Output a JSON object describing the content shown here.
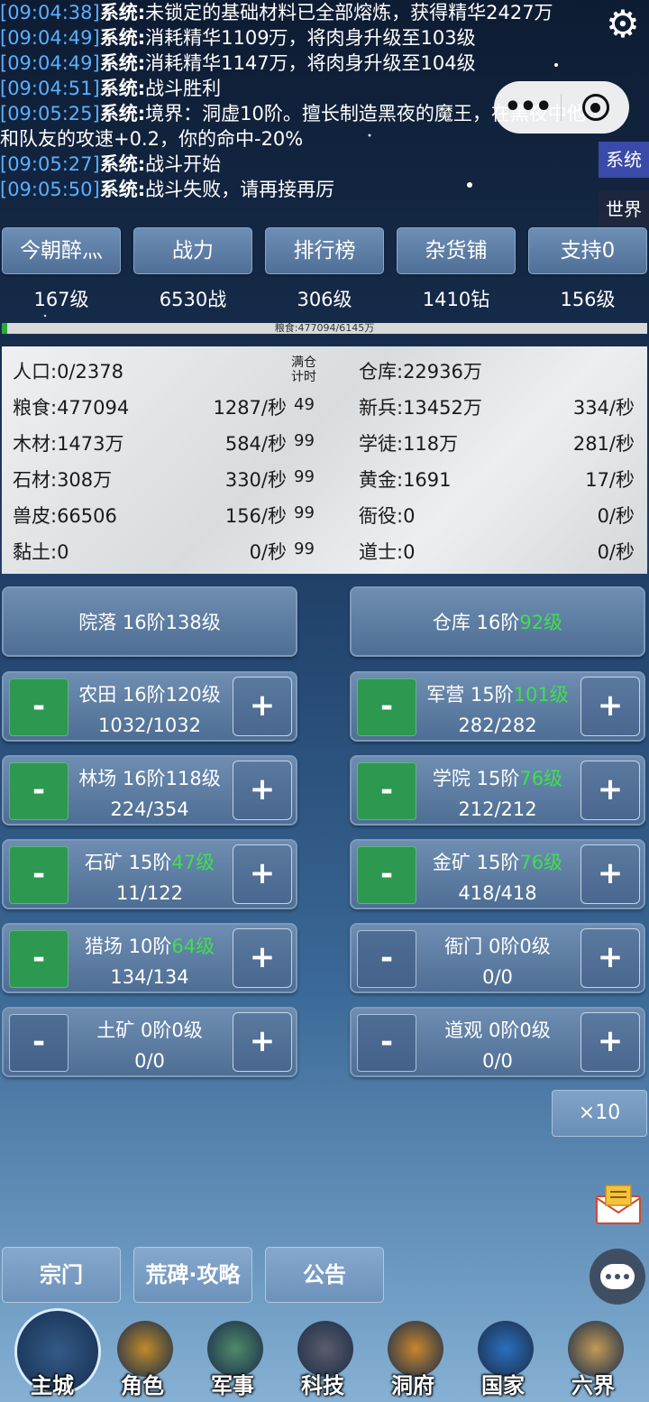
{
  "log": [
    {
      "time": "[09:04:38]",
      "who": "系统:",
      "msg": "未锁定的基础材料已全部熔炼，获得精华2427万"
    },
    {
      "time": "[09:04:49]",
      "who": "系统:",
      "msg": "消耗精华1109万，将肉身升级至103级"
    },
    {
      "time": "[09:04:49]",
      "who": "系统:",
      "msg": "消耗精华1147万，将肉身升级至104级"
    },
    {
      "time": "[09:04:51]",
      "who": "系统:",
      "msg": "战斗胜利"
    },
    {
      "time": "[09:05:25]",
      "who": "系统:",
      "msg": "境界：洞虚10阶。擅长制造黑夜的魔王，在黑夜中他和队友的攻速+0.2，你的命中-20%"
    },
    {
      "time": "[09:05:27]",
      "who": "系统:",
      "msg": "战斗开始"
    },
    {
      "time": "[09:05:50]",
      "who": "系统:",
      "msg": "战斗失败，请再接再厉"
    }
  ],
  "side_tabs": {
    "system": "系统",
    "world": "世界"
  },
  "top_buttons": [
    "今朝醉灬",
    "战力",
    "排行榜",
    "杂货铺",
    "支持0"
  ],
  "stats": [
    "167级",
    "6530战",
    "306级",
    "1410钻",
    "156级"
  ],
  "food_bar": {
    "text": "粮食:477094/6145万",
    "fraction": 0.008
  },
  "resources": {
    "full_time_label": "满仓\n计时",
    "left": [
      {
        "label": "人口:0/2378",
        "rate": "",
        "full": ""
      },
      {
        "label": "粮食:477094",
        "rate": "1287/秒",
        "full": "49"
      },
      {
        "label": "木材:1473万",
        "rate": "584/秒",
        "full": "99"
      },
      {
        "label": "石材:308万",
        "rate": "330/秒",
        "full": "99"
      },
      {
        "label": "兽皮:66506",
        "rate": "156/秒",
        "full": "99"
      },
      {
        "label": "黏土:0",
        "rate": "0/秒",
        "full": "99"
      }
    ],
    "right": [
      {
        "label": "仓库:22936万",
        "rate": ""
      },
      {
        "label": "新兵:13452万",
        "rate": "334/秒"
      },
      {
        "label": "学徒:118万",
        "rate": "281/秒"
      },
      {
        "label": "黄金:1691",
        "rate": "17/秒"
      },
      {
        "label": "衙役:0",
        "rate": "0/秒"
      },
      {
        "label": "道士:0",
        "rate": "0/秒"
      }
    ]
  },
  "buildings": [
    {
      "name": "院落 16阶",
      "level": "138级",
      "green": false,
      "count": "",
      "minus_active": false,
      "has_controls": false
    },
    {
      "name": "仓库 16阶",
      "level": "92级",
      "green": true,
      "count": "",
      "minus_active": false,
      "has_controls": false
    },
    {
      "name": "农田 16阶",
      "level": "120级",
      "green": false,
      "count": "1032/1032",
      "minus_active": true,
      "has_controls": true
    },
    {
      "name": "军营 15阶",
      "level": "101级",
      "green": true,
      "count": "282/282",
      "minus_active": true,
      "has_controls": true
    },
    {
      "name": "林场 16阶",
      "level": "118级",
      "green": false,
      "count": "224/354",
      "minus_active": true,
      "has_controls": true
    },
    {
      "name": "学院 15阶",
      "level": "76级",
      "green": true,
      "count": "212/212",
      "minus_active": true,
      "has_controls": true
    },
    {
      "name": "石矿 15阶",
      "level": "47级",
      "green": true,
      "count": "11/122",
      "minus_active": true,
      "has_controls": true
    },
    {
      "name": "金矿 15阶",
      "level": "76级",
      "green": true,
      "count": "418/418",
      "minus_active": true,
      "has_controls": true
    },
    {
      "name": "猎场 10阶",
      "level": "64级",
      "green": true,
      "count": "134/134",
      "minus_active": true,
      "has_controls": true
    },
    {
      "name": "衙门 0阶",
      "level": "0级",
      "green": false,
      "count": "0/0",
      "minus_active": false,
      "has_controls": true
    },
    {
      "name": "土矿 0阶",
      "level": "0级",
      "green": false,
      "count": "0/0",
      "minus_active": false,
      "has_controls": true
    },
    {
      "name": "道观 0阶",
      "level": "0级",
      "green": false,
      "count": "0/0",
      "minus_active": false,
      "has_controls": true
    }
  ],
  "controls": {
    "minus": "-",
    "plus": "+",
    "multiplier": "×10"
  },
  "bottom_buttons": [
    "宗门",
    "荒碑·攻略",
    "公告"
  ],
  "nav": [
    {
      "label": "主城",
      "icon": "castle-icon",
      "color": "#8a5a2b"
    },
    {
      "label": "角色",
      "icon": "helmet-icon",
      "color": "#c08a2a"
    },
    {
      "label": "军事",
      "icon": "crossed-swords-icon",
      "color": "#4f8a6a"
    },
    {
      "label": "科技",
      "icon": "book-icon",
      "color": "#5c5c6a"
    },
    {
      "label": "洞府",
      "icon": "cave-orb-icon",
      "color": "#c9862d"
    },
    {
      "label": "国家",
      "icon": "globe-icon",
      "color": "#2a6fbe"
    },
    {
      "label": "六界",
      "icon": "scroll-icon",
      "color": "#c29a56"
    }
  ]
}
